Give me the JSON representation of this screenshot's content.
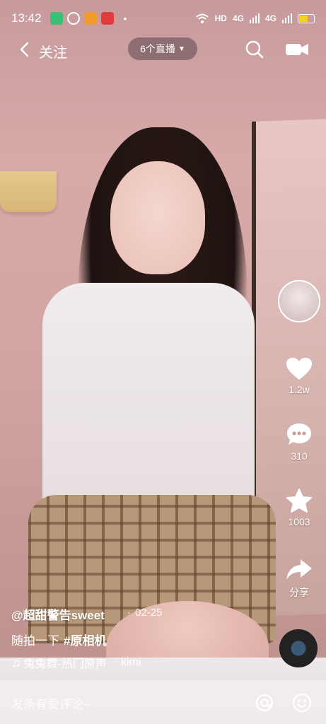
{
  "status_bar": {
    "time": "13:42",
    "network": "HD",
    "signal1": "4G",
    "signal2": "4G",
    "colors": {
      "app1": "#3bbf76",
      "app2": "#ffffff",
      "app3": "#f39a2d",
      "app4": "#e33b3b"
    }
  },
  "nav": {
    "back_label": "关注",
    "live_label": "6个直播"
  },
  "actions": {
    "like_count": "1.2w",
    "comment_count": "310",
    "favorite_count": "1003",
    "share_label": "分享"
  },
  "post": {
    "author": "@超甜警告sweet",
    "date": "02-25",
    "caption_text": "随拍一下",
    "hashtag": "#原相机",
    "music_title": "兔兔舞-热门原声",
    "music_artist": "kimi"
  },
  "comment_bar": {
    "placeholder": "发条有爱评论~"
  }
}
